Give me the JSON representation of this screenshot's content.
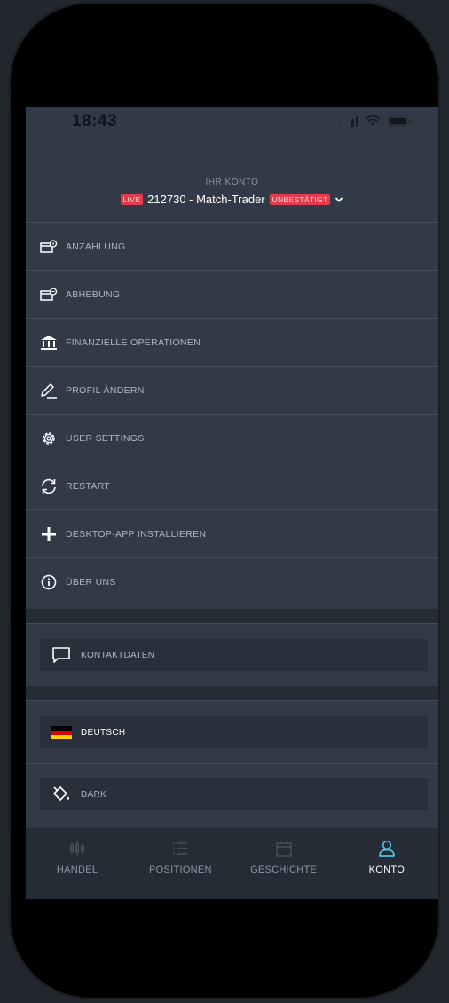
{
  "status_bar": {
    "time": "18:43"
  },
  "account": {
    "label": "IHR KONTO",
    "live_badge": "LIVE",
    "name": "212730 - Match-Trader",
    "status_badge": "UNBESTÄTIGT"
  },
  "menu": {
    "items": [
      {
        "label": "ANZAHLUNG",
        "icon": "deposit-icon"
      },
      {
        "label": "ABHEBUNG",
        "icon": "withdrawal-icon"
      },
      {
        "label": "FINANZIELLE OPERATIONEN",
        "icon": "bank-icon"
      },
      {
        "label": "PROFIL ÄNDERN",
        "icon": "pencil-icon"
      },
      {
        "label": "USER SETTINGS",
        "icon": "gear-icon"
      },
      {
        "label": "RESTART",
        "icon": "refresh-icon"
      },
      {
        "label": "DESKTOP-APP INSTALLIEREN",
        "icon": "plus-icon"
      },
      {
        "label": "ÜBER UNS",
        "icon": "info-icon"
      }
    ]
  },
  "contact": {
    "label": "KONTAKTDATEN",
    "icon": "chat-icon"
  },
  "language": {
    "label": "DEUTSCH",
    "icon": "german-flag-icon"
  },
  "theme": {
    "label": "DARK",
    "icon": "paint-bucket-icon"
  },
  "tabbar": {
    "tabs": [
      {
        "label": "HANDEL",
        "icon": "candlestick-icon",
        "active": false
      },
      {
        "label": "POSITIONEN",
        "icon": "list-icon",
        "active": false
      },
      {
        "label": "GESCHICHTE",
        "icon": "calendar-icon",
        "active": false
      },
      {
        "label": "KONTO",
        "icon": "user-icon",
        "active": true
      }
    ]
  },
  "colors": {
    "background": "#323a48",
    "accent": "#4fc3e8",
    "badge_red": "#e53a4d",
    "text_muted": "#aeb6c3"
  }
}
